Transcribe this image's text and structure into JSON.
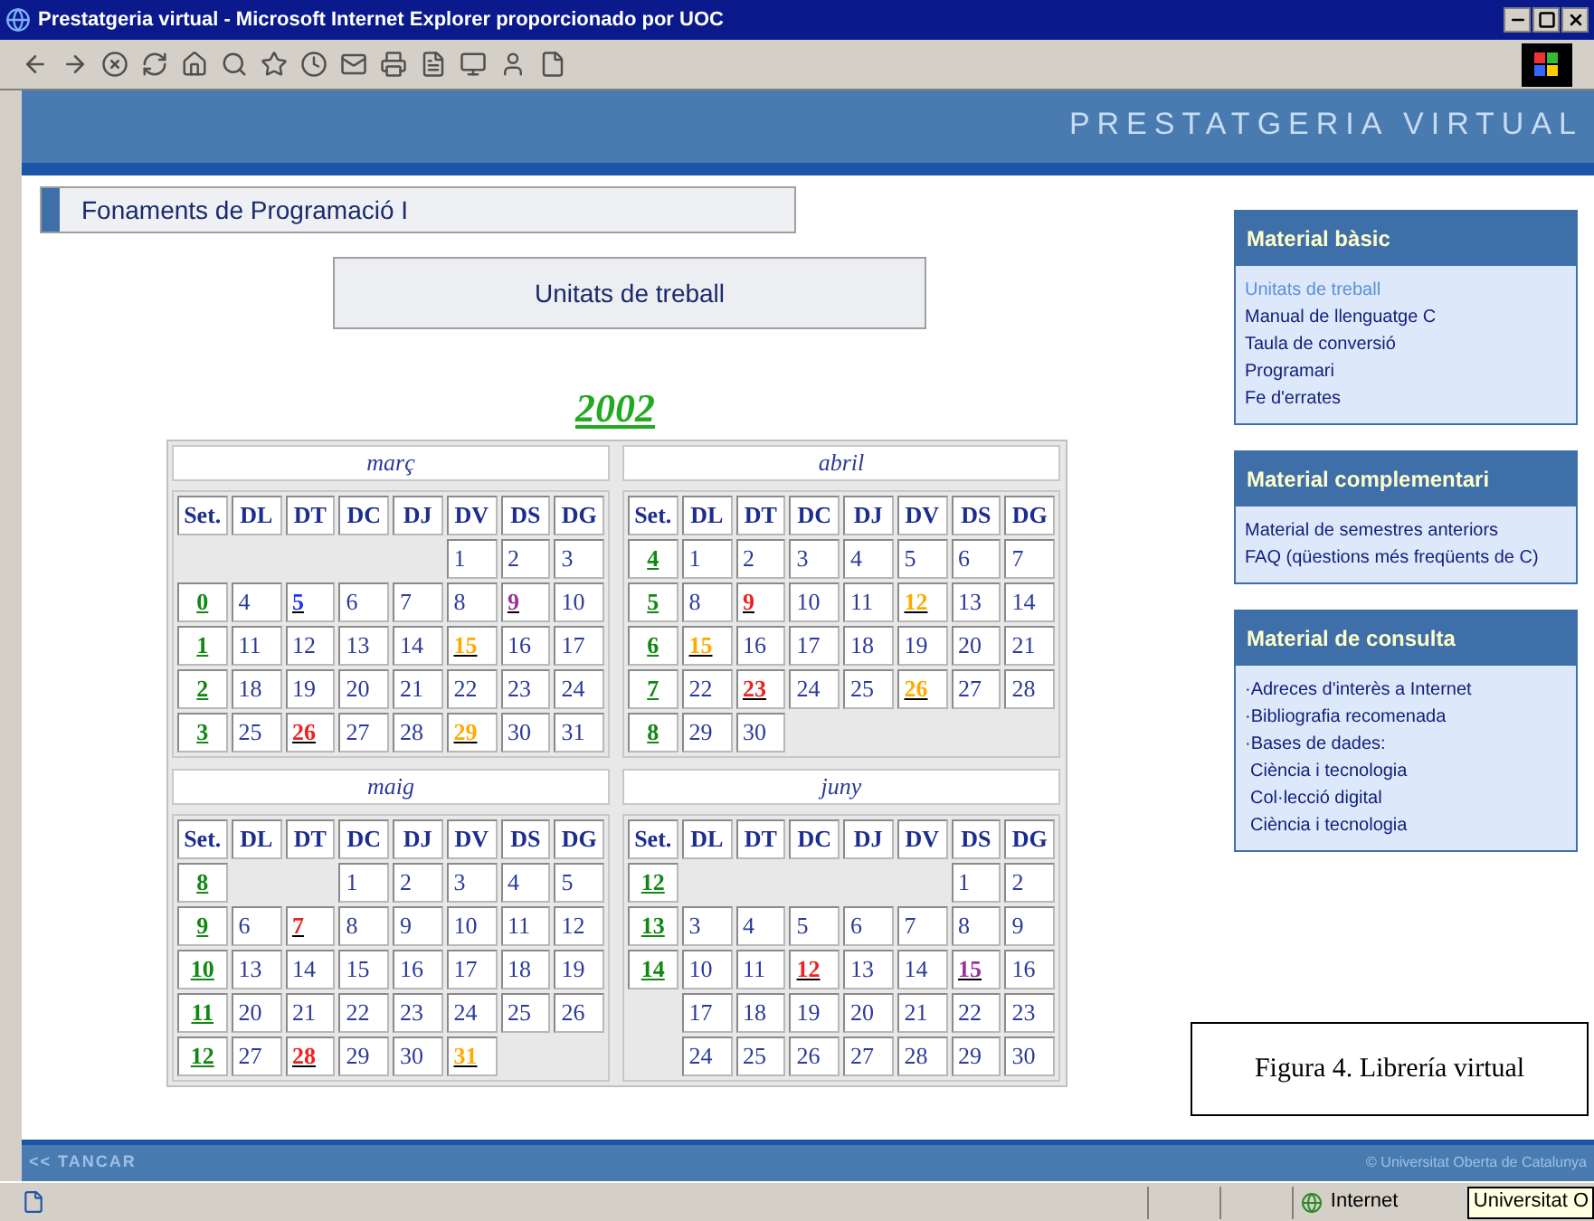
{
  "window": {
    "title": "Prestatgeria virtual - Microsoft Internet Explorer proporcionado por UOC"
  },
  "banner": {
    "title": "PRESTATGERIA VIRTUAL"
  },
  "course": {
    "title": "Fonaments de Programació I"
  },
  "section_button": {
    "label": "Unitats de treball"
  },
  "year": "2002",
  "calendars": [
    {
      "month": "març",
      "headers": [
        "Set.",
        "DL",
        "DT",
        "DC",
        "DJ",
        "DV",
        "DS",
        "DG"
      ],
      "weeks": [
        {
          "days": [
            {
              "kind": "blank"
            },
            {
              "kind": "blank"
            },
            {
              "kind": "blank"
            },
            {
              "kind": "blank"
            },
            {
              "kind": "day",
              "text": "1"
            },
            {
              "kind": "day",
              "text": "2"
            },
            {
              "kind": "day",
              "text": "3"
            }
          ]
        },
        {
          "week": "0",
          "days": [
            {
              "kind": "day",
              "text": "4"
            },
            {
              "kind": "day",
              "text": "5",
              "color": "#2233ee"
            },
            {
              "kind": "day",
              "text": "6"
            },
            {
              "kind": "day",
              "text": "7"
            },
            {
              "kind": "day",
              "text": "8"
            },
            {
              "kind": "day",
              "text": "9",
              "color": "#993399"
            },
            {
              "kind": "day",
              "text": "10"
            }
          ]
        },
        {
          "week": "1",
          "days": [
            {
              "kind": "day",
              "text": "11"
            },
            {
              "kind": "day",
              "text": "12"
            },
            {
              "kind": "day",
              "text": "13"
            },
            {
              "kind": "day",
              "text": "14"
            },
            {
              "kind": "day",
              "text": "15",
              "color": "#ffaa00"
            },
            {
              "kind": "day",
              "text": "16"
            },
            {
              "kind": "day",
              "text": "17"
            }
          ]
        },
        {
          "week": "2",
          "days": [
            {
              "kind": "day",
              "text": "18"
            },
            {
              "kind": "day",
              "text": "19"
            },
            {
              "kind": "day",
              "text": "20"
            },
            {
              "kind": "day",
              "text": "21"
            },
            {
              "kind": "day",
              "text": "22"
            },
            {
              "kind": "day",
              "text": "23"
            },
            {
              "kind": "day",
              "text": "24"
            }
          ]
        },
        {
          "week": "3",
          "days": [
            {
              "kind": "day",
              "text": "25"
            },
            {
              "kind": "day",
              "text": "26",
              "color": "#ee2222"
            },
            {
              "kind": "day",
              "text": "27"
            },
            {
              "kind": "day",
              "text": "28"
            },
            {
              "kind": "day",
              "text": "29",
              "color": "#ffaa00"
            },
            {
              "kind": "day",
              "text": "30"
            },
            {
              "kind": "day",
              "text": "31"
            }
          ]
        }
      ]
    },
    {
      "month": "abril",
      "headers": [
        "Set.",
        "DL",
        "DT",
        "DC",
        "DJ",
        "DV",
        "DS",
        "DG"
      ],
      "weeks": [
        {
          "week": "4",
          "days": [
            {
              "kind": "day",
              "text": "1"
            },
            {
              "kind": "day",
              "text": "2"
            },
            {
              "kind": "day",
              "text": "3"
            },
            {
              "kind": "day",
              "text": "4"
            },
            {
              "kind": "day",
              "text": "5"
            },
            {
              "kind": "day",
              "text": "6"
            },
            {
              "kind": "day",
              "text": "7"
            }
          ]
        },
        {
          "week": "5",
          "days": [
            {
              "kind": "day",
              "text": "8"
            },
            {
              "kind": "day",
              "text": "9",
              "color": "#ee2222"
            },
            {
              "kind": "day",
              "text": "10"
            },
            {
              "kind": "day",
              "text": "11"
            },
            {
              "kind": "day",
              "text": "12",
              "color": "#ffaa00"
            },
            {
              "kind": "day",
              "text": "13"
            },
            {
              "kind": "day",
              "text": "14"
            }
          ]
        },
        {
          "week": "6",
          "days": [
            {
              "kind": "day",
              "text": "15",
              "color": "#ffaa00"
            },
            {
              "kind": "day",
              "text": "16"
            },
            {
              "kind": "day",
              "text": "17"
            },
            {
              "kind": "day",
              "text": "18"
            },
            {
              "kind": "day",
              "text": "19"
            },
            {
              "kind": "day",
              "text": "20"
            },
            {
              "kind": "day",
              "text": "21"
            }
          ]
        },
        {
          "week": "7",
          "days": [
            {
              "kind": "day",
              "text": "22"
            },
            {
              "kind": "day",
              "text": "23",
              "color": "#ee2222"
            },
            {
              "kind": "day",
              "text": "24"
            },
            {
              "kind": "day",
              "text": "25"
            },
            {
              "kind": "day",
              "text": "26",
              "color": "#ffaa00"
            },
            {
              "kind": "day",
              "text": "27"
            },
            {
              "kind": "day",
              "text": "28"
            }
          ]
        },
        {
          "week": "8",
          "days": [
            {
              "kind": "day",
              "text": "29"
            },
            {
              "kind": "day",
              "text": "30"
            },
            {
              "kind": "blank"
            },
            {
              "kind": "blank"
            },
            {
              "kind": "blank"
            },
            {
              "kind": "blank"
            },
            {
              "kind": "blank"
            }
          ]
        }
      ]
    },
    {
      "month": "maig",
      "headers": [
        "Set.",
        "DL",
        "DT",
        "DC",
        "DJ",
        "DV",
        "DS",
        "DG"
      ],
      "weeks": [
        {
          "week": "8",
          "days": [
            {
              "kind": "blank"
            },
            {
              "kind": "blank"
            },
            {
              "kind": "day",
              "text": "1"
            },
            {
              "kind": "day",
              "text": "2"
            },
            {
              "kind": "day",
              "text": "3"
            },
            {
              "kind": "day",
              "text": "4"
            },
            {
              "kind": "day",
              "text": "5"
            }
          ]
        },
        {
          "week": "9",
          "days": [
            {
              "kind": "day",
              "text": "6"
            },
            {
              "kind": "day",
              "text": "7",
              "color": "#ee2222"
            },
            {
              "kind": "day",
              "text": "8"
            },
            {
              "kind": "day",
              "text": "9"
            },
            {
              "kind": "day",
              "text": "10"
            },
            {
              "kind": "day",
              "text": "11"
            },
            {
              "kind": "day",
              "text": "12"
            }
          ]
        },
        {
          "week": "10",
          "days": [
            {
              "kind": "day",
              "text": "13"
            },
            {
              "kind": "day",
              "text": "14"
            },
            {
              "kind": "day",
              "text": "15"
            },
            {
              "kind": "day",
              "text": "16"
            },
            {
              "kind": "day",
              "text": "17"
            },
            {
              "kind": "day",
              "text": "18"
            },
            {
              "kind": "day",
              "text": "19"
            }
          ]
        },
        {
          "week": "11",
          "days": [
            {
              "kind": "day",
              "text": "20"
            },
            {
              "kind": "day",
              "text": "21"
            },
            {
              "kind": "day",
              "text": "22"
            },
            {
              "kind": "day",
              "text": "23"
            },
            {
              "kind": "day",
              "text": "24"
            },
            {
              "kind": "day",
              "text": "25"
            },
            {
              "kind": "day",
              "text": "26"
            }
          ]
        },
        {
          "week": "12",
          "days": [
            {
              "kind": "day",
              "text": "27"
            },
            {
              "kind": "day",
              "text": "28",
              "color": "#ee2222"
            },
            {
              "kind": "day",
              "text": "29"
            },
            {
              "kind": "day",
              "text": "30"
            },
            {
              "kind": "day",
              "text": "31",
              "color": "#ffaa00"
            },
            {
              "kind": "blank"
            },
            {
              "kind": "blank"
            }
          ]
        }
      ]
    },
    {
      "month": "juny",
      "headers": [
        "Set.",
        "DL",
        "DT",
        "DC",
        "DJ",
        "DV",
        "DS",
        "DG"
      ],
      "weeks": [
        {
          "week": "12",
          "days": [
            {
              "kind": "blank"
            },
            {
              "kind": "blank"
            },
            {
              "kind": "blank"
            },
            {
              "kind": "blank"
            },
            {
              "kind": "blank"
            },
            {
              "kind": "day",
              "text": "1"
            },
            {
              "kind": "day",
              "text": "2"
            }
          ]
        },
        {
          "week": "13",
          "days": [
            {
              "kind": "day",
              "text": "3"
            },
            {
              "kind": "day",
              "text": "4"
            },
            {
              "kind": "day",
              "text": "5"
            },
            {
              "kind": "day",
              "text": "6"
            },
            {
              "kind": "day",
              "text": "7"
            },
            {
              "kind": "day",
              "text": "8"
            },
            {
              "kind": "day",
              "text": "9"
            }
          ]
        },
        {
          "week": "14",
          "days": [
            {
              "kind": "day",
              "text": "10"
            },
            {
              "kind": "day",
              "text": "11"
            },
            {
              "kind": "day",
              "text": "12",
              "color": "#ee2222"
            },
            {
              "kind": "day",
              "text": "13"
            },
            {
              "kind": "day",
              "text": "14"
            },
            {
              "kind": "day",
              "text": "15",
              "color": "#993399"
            },
            {
              "kind": "day",
              "text": "16"
            }
          ]
        },
        {
          "days": [
            {
              "kind": "day",
              "text": "17"
            },
            {
              "kind": "day",
              "text": "18"
            },
            {
              "kind": "day",
              "text": "19"
            },
            {
              "kind": "day",
              "text": "20"
            },
            {
              "kind": "day",
              "text": "21"
            },
            {
              "kind": "day",
              "text": "22"
            },
            {
              "kind": "day",
              "text": "23"
            }
          ]
        },
        {
          "days": [
            {
              "kind": "day",
              "text": "24"
            },
            {
              "kind": "day",
              "text": "25"
            },
            {
              "kind": "day",
              "text": "26"
            },
            {
              "kind": "day",
              "text": "27"
            },
            {
              "kind": "day",
              "text": "28"
            },
            {
              "kind": "day",
              "text": "29"
            },
            {
              "kind": "day",
              "text": "30"
            }
          ]
        }
      ]
    }
  ],
  "sidebar": [
    {
      "title": "Material bàsic",
      "links": [
        {
          "text": "Unitats de treball",
          "selected": true
        },
        {
          "text": "Manual de llenguatge C",
          "selected": false
        },
        {
          "text": "Taula de conversió",
          "selected": false
        },
        {
          "text": "Programari",
          "selected": false
        },
        {
          "text": "Fe d'errates",
          "selected": false
        }
      ]
    },
    {
      "title": "Material complementari",
      "links": [
        {
          "text": "Material de semestres anteriors",
          "selected": false
        },
        {
          "text": "FAQ (qüestions més freqüents de C)",
          "selected": false
        }
      ]
    },
    {
      "title": "Material de consulta",
      "links": [
        {
          "text": "·Adreces d'interès a Internet",
          "selected": false
        },
        {
          "text": "·Bibliografia recomenada",
          "selected": false
        },
        {
          "text": "·Bases de dades:",
          "selected": false,
          "children": [
            {
              "text": "Ciència i tecnologia",
              "selected": false
            },
            {
              "text": "Col·lecció digital",
              "selected": false
            },
            {
              "text": "Ciència i tecnologia",
              "selected": false
            }
          ]
        }
      ]
    }
  ],
  "footer": {
    "close_link": "<< TANCAR",
    "copyright": "© Universitat Oberta de Catalunya"
  },
  "status_bar": {
    "zone": "Internet",
    "tooltip": "Universitat O"
  },
  "caption": "Figura 4. Librería virtual"
}
